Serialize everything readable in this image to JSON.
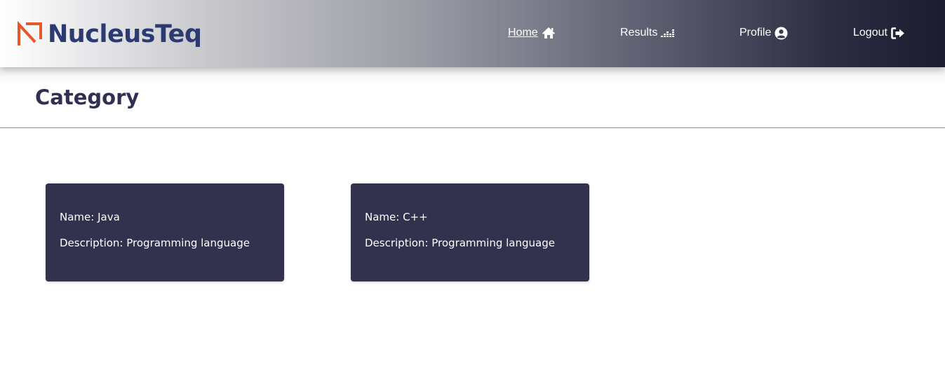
{
  "brand": {
    "name": "NucleusTeq",
    "text_color": "#2b3b72",
    "mark_color": "#e8572a",
    "mark_icon": "nucleusteq-logo-icon"
  },
  "nav": {
    "home": {
      "label": "Home",
      "icon": "home-icon",
      "active": true
    },
    "results": {
      "label": "Results",
      "icon": "chart-bars-icon"
    },
    "profile": {
      "label": "Profile",
      "icon": "user-circle-icon"
    },
    "logout": {
      "label": "Logout",
      "icon": "sign-out-icon"
    }
  },
  "page": {
    "title": "Category"
  },
  "categories": [
    {
      "name_label": "Name: Java",
      "description_label": "Description: Programming language"
    },
    {
      "name_label": "Name: C++",
      "description_label": "Description: Programming language"
    }
  ],
  "colors": {
    "card_background": "#32324f",
    "title_color": "#2f3150",
    "nav_gradient_end": "#1b1c30"
  }
}
